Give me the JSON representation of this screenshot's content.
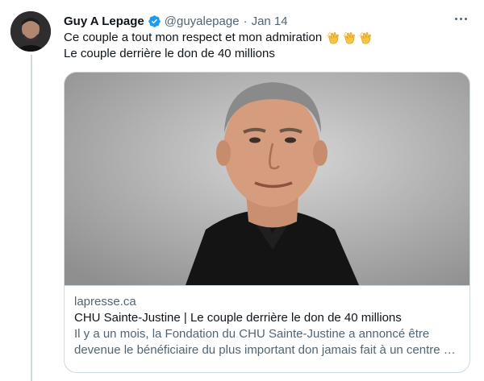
{
  "tweet": {
    "author_name": "Guy A Lepage",
    "handle": "@guyalepage",
    "separator": "·",
    "date": "Jan 14",
    "verified": true,
    "line1": "Ce couple a tout mon respect et mon admiration",
    "line2": "Le couple derrière le don de 40 millions",
    "emoji": [
      "clapping-hands",
      "clapping-hands",
      "clapping-hands"
    ]
  },
  "card": {
    "domain": "lapresse.ca",
    "title": "CHU Sainte-Justine | Le couple derrière le don de 40 millions",
    "description_line1": "Il y a un mois, la Fondation du CHU Sainte-Justine a annoncé être",
    "description_line2": "devenue le bénéficiaire du plus important don jamais fait à un centre …"
  },
  "icons": {
    "verified": "verified-badge-icon",
    "more": "more-options-icon"
  },
  "colors": {
    "accent": "#1d9bf0",
    "text_primary": "#0f1419",
    "text_secondary": "#536471",
    "border": "#cfd9de"
  }
}
